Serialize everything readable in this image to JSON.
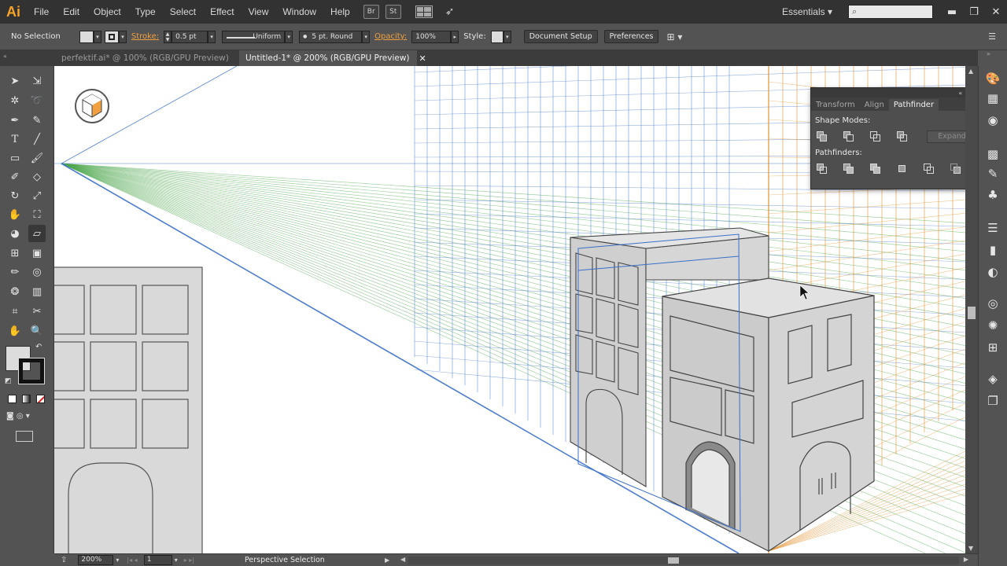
{
  "app": {
    "logo": "Ai",
    "menu": [
      "File",
      "Edit",
      "Object",
      "Type",
      "Select",
      "Effect",
      "View",
      "Window",
      "Help"
    ],
    "bridge_label": "Br",
    "stock_label": "St",
    "workspace": "Essentials",
    "search_placeholder": ""
  },
  "control_bar": {
    "selection": "No Selection",
    "stroke_label": "Stroke:",
    "stroke_value": "0.5 pt",
    "stroke_profile": "Uniform",
    "brush": "5 pt. Round",
    "opacity_label": "Opacity:",
    "opacity_value": "100%",
    "style_label": "Style:",
    "document_setup": "Document Setup",
    "preferences": "Preferences"
  },
  "tabs": [
    {
      "label": "perfektif.ai* @ 100% (RGB/GPU Preview)",
      "close": "✕",
      "active": false
    },
    {
      "label": "Untitled-1* @ 200% (RGB/GPU Preview)",
      "close": "✕",
      "active": true
    }
  ],
  "pathfinder_panel": {
    "tabs": [
      "Transform",
      "Align",
      "Pathfinder"
    ],
    "active_tab": "Pathfinder",
    "shape_modes_label": "Shape Modes:",
    "pathfinders_label": "Pathfinders:",
    "expand_label": "Expand"
  },
  "status_bar": {
    "zoom": "200%",
    "page": "1",
    "tool_name": "Perspective Selection"
  },
  "colors": {
    "grid_blue": "#3a6fc9",
    "grid_orange": "#e08a1e",
    "grid_green": "#4fa84f",
    "building_fill": "#d9d9d9",
    "accent": "#f7a426"
  },
  "icons": {
    "toolbar": [
      "selection-arrow-icon",
      "direct-selection-icon",
      "magic-wand-icon",
      "lasso-icon",
      "pen-icon",
      "curvature-icon",
      "type-icon",
      "line-icon",
      "rectangle-icon",
      "paintbrush-icon",
      "shaper-icon",
      "eraser-icon",
      "rotate-icon",
      "scale-icon",
      "warp-icon",
      "free-transform-icon",
      "shape-builder-icon",
      "perspective-grid-icon",
      "mesh-icon",
      "gradient-icon",
      "eyedropper-icon",
      "blend-icon",
      "symbol-sprayer-icon",
      "column-graph-icon",
      "artboard-icon",
      "slice-icon",
      "hand-icon",
      "zoom-icon"
    ]
  }
}
